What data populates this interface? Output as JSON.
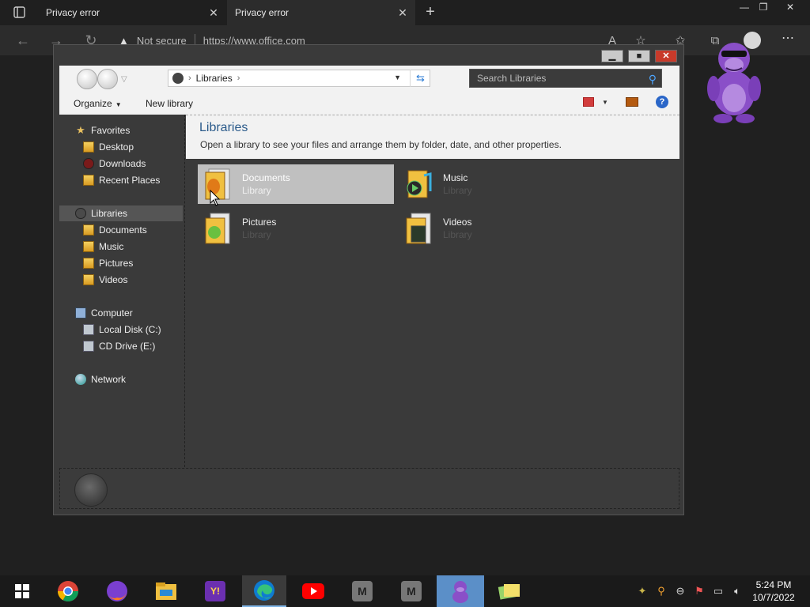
{
  "browser": {
    "tabs": [
      {
        "title": "Privacy error"
      },
      {
        "title": "Privacy error"
      }
    ],
    "security_label": "Not secure",
    "url": "https://www.office.com"
  },
  "explorer": {
    "breadcrumb": [
      "Libraries"
    ],
    "search_placeholder": "Search Libraries",
    "organize_label": "Organize",
    "new_library_label": "New library",
    "help_label": "?",
    "header": {
      "title": "Libraries",
      "subtitle": "Open a library to see your files and arrange them by folder, date, and other properties."
    },
    "nav": {
      "favorites": {
        "label": "Favorites",
        "items": [
          "Desktop",
          "Downloads",
          "Recent Places"
        ]
      },
      "libraries": {
        "label": "Libraries",
        "items": [
          "Documents",
          "Music",
          "Pictures",
          "Videos"
        ]
      },
      "computer": {
        "label": "Computer",
        "items": [
          "Local Disk (C:)",
          "CD Drive (E:)"
        ]
      },
      "network": {
        "label": "Network"
      }
    },
    "tiles": [
      {
        "name": "Documents",
        "type": "Library",
        "selected": true
      },
      {
        "name": "Music",
        "type": "Library"
      },
      {
        "name": "Pictures",
        "type": "Library"
      },
      {
        "name": "Videos",
        "type": "Library"
      }
    ]
  },
  "taskbar": {
    "apps": [
      "start-icon",
      "chrome-icon",
      "firefox-icon",
      "file-explorer-icon",
      "yahoo-icon",
      "edge-icon",
      "youtube-icon",
      "app-m-icon",
      "app-m-icon",
      "bonzi-icon",
      "notes-icon"
    ],
    "app_letters": {
      "m1": "M",
      "m2": "M",
      "yahoo": "Y!"
    },
    "time": "5:24 PM",
    "date": "10/7/2022"
  },
  "colors": {
    "accent": "#7fb4e6",
    "title_blue": "#2a5a8a",
    "close_red": "#c83a2a",
    "bonzi_purple": "#8a4fc8"
  }
}
